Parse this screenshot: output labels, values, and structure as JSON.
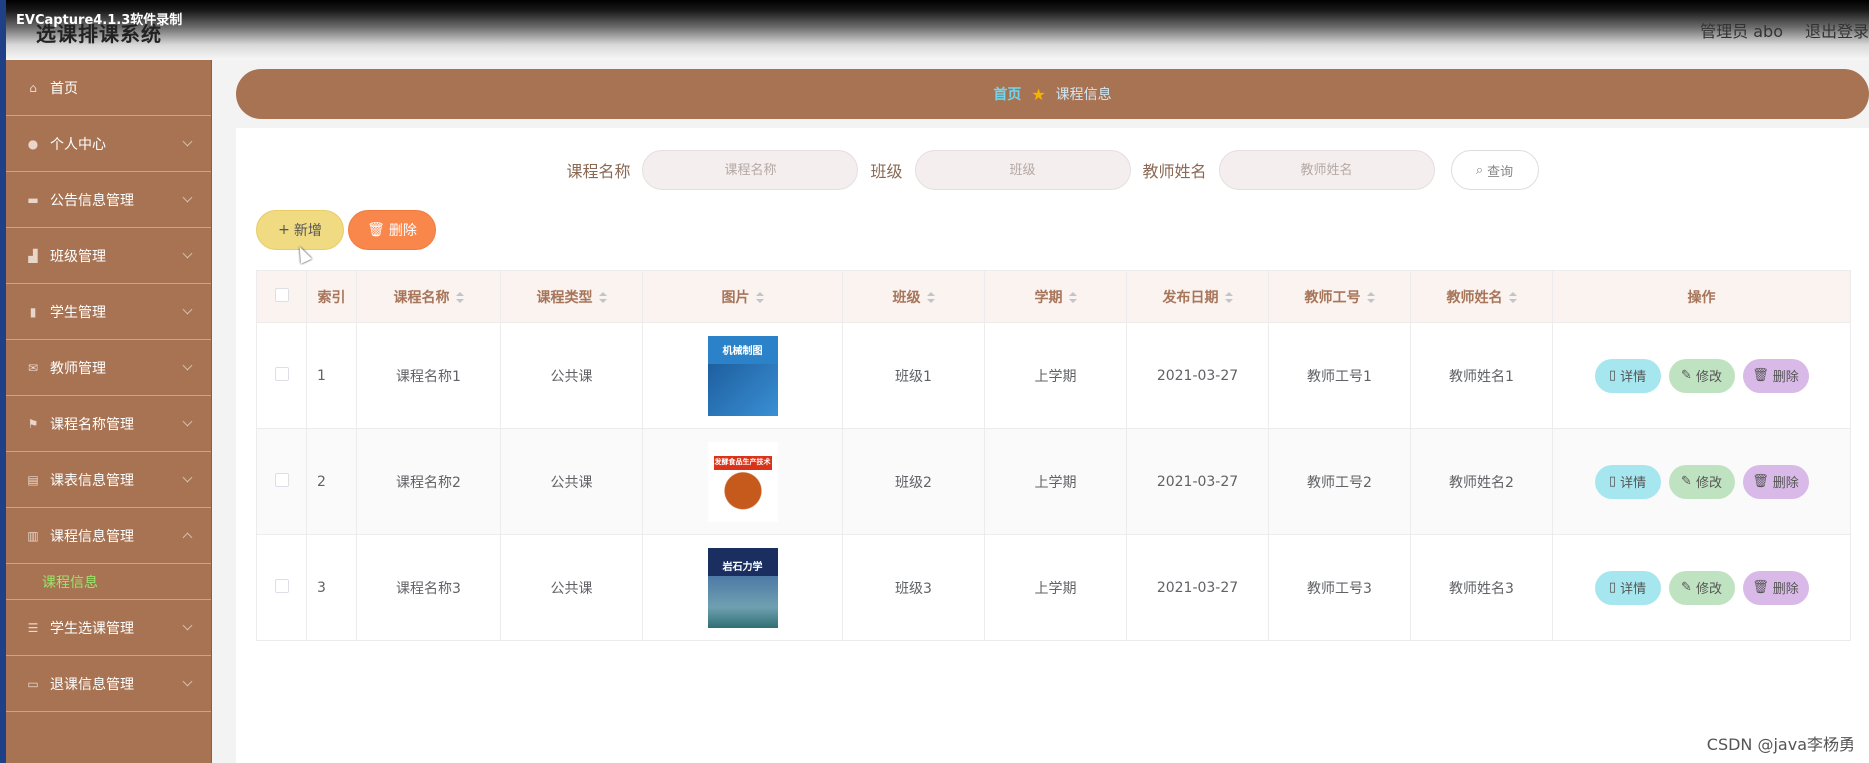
{
  "capture_label": "EVCapture4.1.3软件录制",
  "app_title": "选课排课系统",
  "header": {
    "user": "管理员 abo",
    "logout": "退出登录"
  },
  "sidebar": {
    "items": [
      {
        "label": "首页",
        "icon": "home-icon",
        "has_arrow": false
      },
      {
        "label": "个人中心",
        "icon": "user-icon",
        "has_arrow": true
      },
      {
        "label": "公告信息管理",
        "icon": "message-icon",
        "has_arrow": true
      },
      {
        "label": "班级管理",
        "icon": "chart-icon",
        "has_arrow": true
      },
      {
        "label": "学生管理",
        "icon": "bar-chart-icon",
        "has_arrow": true
      },
      {
        "label": "教师管理",
        "icon": "mail-icon",
        "has_arrow": true
      },
      {
        "label": "课程名称管理",
        "icon": "flag-icon",
        "has_arrow": true
      },
      {
        "label": "课表信息管理",
        "icon": "briefcase-icon",
        "has_arrow": true
      },
      {
        "label": "课程信息管理",
        "icon": "clipboard-icon",
        "has_arrow": true,
        "expanded": true
      },
      {
        "label": "学生选课管理",
        "icon": "sliders-icon",
        "has_arrow": true
      },
      {
        "label": "退课信息管理",
        "icon": "monitor-icon",
        "has_arrow": true
      }
    ],
    "submenu": {
      "label": "课程信息"
    }
  },
  "breadcrumb": {
    "home": "首页",
    "current": "课程信息"
  },
  "search": {
    "course_label": "课程名称",
    "course_placeholder": "课程名称",
    "class_label": "班级",
    "class_placeholder": "班级",
    "teacher_label": "教师姓名",
    "teacher_placeholder": "教师姓名",
    "query": "查询"
  },
  "actions": {
    "add": "新增",
    "delete": "删除"
  },
  "table": {
    "headers": {
      "index": "索引",
      "course_name": "课程名称",
      "course_type": "课程类型",
      "image": "图片",
      "class": "班级",
      "term": "学期",
      "date": "发布日期",
      "teacher_no": "教师工号",
      "teacher_name": "教师姓名",
      "ops": "操作"
    },
    "rows": [
      {
        "index": "1",
        "course_name": "课程名称1",
        "course_type": "公共课",
        "class": "班级1",
        "term": "上学期",
        "date": "2021-03-27",
        "teacher_no": "教师工号1",
        "teacher_name": "教师姓名1",
        "book_text": "机械制图"
      },
      {
        "index": "2",
        "course_name": "课程名称2",
        "course_type": "公共课",
        "class": "班级2",
        "term": "上学期",
        "date": "2021-03-27",
        "teacher_no": "教师工号2",
        "teacher_name": "教师姓名2",
        "book_text": "发酵食品生产技术"
      },
      {
        "index": "3",
        "course_name": "课程名称3",
        "course_type": "公共课",
        "class": "班级3",
        "term": "上学期",
        "date": "2021-03-27",
        "teacher_no": "教师工号3",
        "teacher_name": "教师姓名3",
        "book_text": "岩石力学"
      }
    ],
    "ops": {
      "detail": "详情",
      "edit": "修改",
      "delete": "删除"
    }
  },
  "watermark": "CSDN @java李杨勇",
  "colors": {
    "sidebar": "#a87352",
    "accent_link": "#9be46b"
  }
}
